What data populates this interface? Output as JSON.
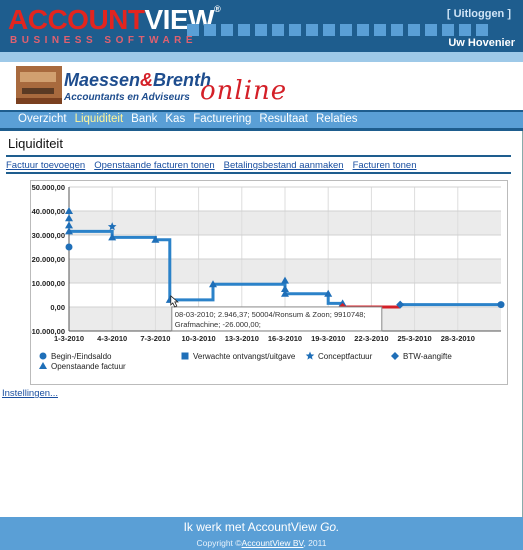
{
  "header": {
    "logo_part1": "ACCOUNT",
    "logo_part2": "VIEW",
    "logo_reg": "®",
    "logo_subtitle": "BUSINESS SOFTWARE",
    "logout_label": "[ Uitloggen ]",
    "user_name": "Uw Hovenier"
  },
  "banner": {
    "firm_name_a": "Maessen",
    "firm_name_amp": "&",
    "firm_name_b": "Brenth",
    "firm_subtitle": "Accountants en Adviseurs",
    "online_text": "online"
  },
  "nav": {
    "items": [
      {
        "label": "Overzicht",
        "active": false
      },
      {
        "label": "Liquiditeit",
        "active": true
      },
      {
        "label": "Bank",
        "active": false
      },
      {
        "label": "Kas",
        "active": false
      },
      {
        "label": "Facturering",
        "active": false
      },
      {
        "label": "Resultaat",
        "active": false
      },
      {
        "label": "Relaties",
        "active": false
      }
    ]
  },
  "page": {
    "title": "Liquiditeit",
    "actions": [
      "Factuur toevoegen",
      "Openstaande facturen tonen",
      "Betalingsbestand aanmaken",
      "Facturen tonen"
    ],
    "settings_link": "Instellingen..."
  },
  "colors": {
    "header_blue": "#1e5d8e",
    "nav_blue": "#5a9fd6",
    "line_blue": "#2b82c9",
    "line_red": "#d42028",
    "logo_red": "#e2251f"
  },
  "chart_data": {
    "type": "line",
    "y_ticks": [
      "50.000,00",
      "40.000,00",
      "30.000,00",
      "20.000,00",
      "10.000,00",
      "0,00",
      "-10.000,00"
    ],
    "y_tick_values": [
      50000,
      40000,
      30000,
      20000,
      10000,
      0,
      -10000
    ],
    "ylim": [
      -10000,
      50000
    ],
    "x_ticks": [
      "1-3-2010",
      "4-3-2010",
      "7-3-2010",
      "10-3-2010",
      "13-3-2010",
      "16-3-2010",
      "19-3-2010",
      "22-3-2010",
      "25-3-2010",
      "28-3-2010"
    ],
    "x_tick_days": [
      1,
      4,
      7,
      10,
      13,
      16,
      19,
      22,
      25,
      28
    ],
    "xlim": [
      1,
      31
    ],
    "grid": true,
    "series": [
      {
        "name": "",
        "color": "#2b82c9",
        "points": [
          [
            1,
            31500
          ],
          [
            4,
            31500
          ],
          [
            4,
            29000
          ],
          [
            7,
            29000
          ],
          [
            7,
            28000
          ],
          [
            8,
            28000
          ],
          [
            8,
            2946.37
          ],
          [
            11,
            2946.37
          ],
          [
            11,
            9500
          ],
          [
            16,
            9500
          ],
          [
            16,
            5500
          ],
          [
            19,
            5500
          ],
          [
            19,
            1500
          ],
          [
            20,
            1500
          ],
          [
            20,
            0
          ]
        ]
      },
      {
        "name": "",
        "color": "#d42028",
        "points": [
          [
            20,
            0
          ],
          [
            24,
            0
          ]
        ]
      },
      {
        "name": "",
        "color": "#2b82c9",
        "points": [
          [
            24,
            0
          ],
          [
            24,
            1000
          ],
          [
            31,
            1000
          ]
        ]
      }
    ],
    "markers": [
      {
        "kind": "circle",
        "x": 1,
        "y": 25000
      },
      {
        "kind": "triangle",
        "x": 1,
        "y": 40000
      },
      {
        "kind": "triangle",
        "x": 1,
        "y": 37000
      },
      {
        "kind": "triangle",
        "x": 1,
        "y": 34000
      },
      {
        "kind": "triangle",
        "x": 1,
        "y": 31500
      },
      {
        "kind": "triangle",
        "x": 4,
        "y": 29000
      },
      {
        "kind": "star",
        "x": 4,
        "y": 33500
      },
      {
        "kind": "triangle",
        "x": 7,
        "y": 28000
      },
      {
        "kind": "triangle",
        "x": 8,
        "y": 2946.37
      },
      {
        "kind": "triangle",
        "x": 11,
        "y": 9500
      },
      {
        "kind": "triangle",
        "x": 16,
        "y": 11000
      },
      {
        "kind": "triangle",
        "x": 16,
        "y": 7500
      },
      {
        "kind": "triangle",
        "x": 16,
        "y": 5500
      },
      {
        "kind": "triangle",
        "x": 19,
        "y": 5500
      },
      {
        "kind": "triangle",
        "x": 20,
        "y": 1500
      },
      {
        "kind": "diamond",
        "x": 20,
        "y": 0
      },
      {
        "kind": "diamond",
        "x": 24,
        "y": 1000
      },
      {
        "kind": "circle",
        "x": 31,
        "y": 1000
      }
    ],
    "tooltip": {
      "line1": "08-03-2010; 2.946,37; 50004/Ronsum & Zoon; 9910748;",
      "line2": "Grafmachine; -26.000,00;"
    },
    "legend": [
      {
        "kind": "circle",
        "label": "Begin-/Eindsaldo"
      },
      {
        "kind": "square",
        "label": "Verwachte ontvangst/uitgave"
      },
      {
        "kind": "star",
        "label": "Conceptfactuur"
      },
      {
        "kind": "diamond",
        "label": "BTW-aangifte"
      },
      {
        "kind": "triangle",
        "label": "Openstaande factuur"
      }
    ]
  },
  "footer": {
    "slogan": "Ik werk met AccountView",
    "slogan_go": "Go.",
    "copyright_prefix": "Copyright ©",
    "copyright_link": "AccountView BV",
    "copyright_year": ", 2011"
  }
}
